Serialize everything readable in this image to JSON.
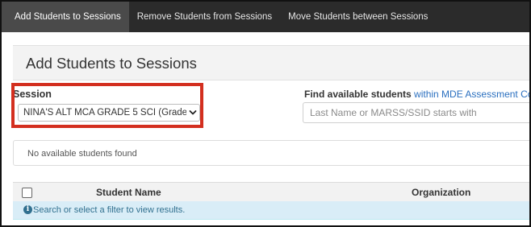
{
  "nav": {
    "tabs": [
      {
        "label": "Add Students to Sessions",
        "active": true
      },
      {
        "label": "Remove Students from Sessions",
        "active": false
      },
      {
        "label": "Move Students between Sessions",
        "active": false
      }
    ]
  },
  "panel": {
    "title": "Add Students to Sessions"
  },
  "session": {
    "label": "Session",
    "selected": "NINA'S ALT MCA GRADE 5 SCI (Grade"
  },
  "find": {
    "label_bold": "Find available students",
    "label_link": "within MDE Assessment Co",
    "placeholder": "Last Name or MARSS/SSID starts with"
  },
  "results": {
    "empty_message": "No available students found"
  },
  "table": {
    "columns": [
      "Student Name",
      "Organization"
    ],
    "info_message": "Search or select a filter to view results."
  },
  "colors": {
    "nav_bg": "#2b2b2b",
    "highlight": "#d32f1f",
    "link": "#2a6fbf",
    "info_bg": "#d9edf7",
    "info_text": "#31708f"
  },
  "icons": {
    "select_chevron": "chevron-down-icon",
    "info": "info-circle-icon",
    "checkbox": "checkbox-icon"
  }
}
